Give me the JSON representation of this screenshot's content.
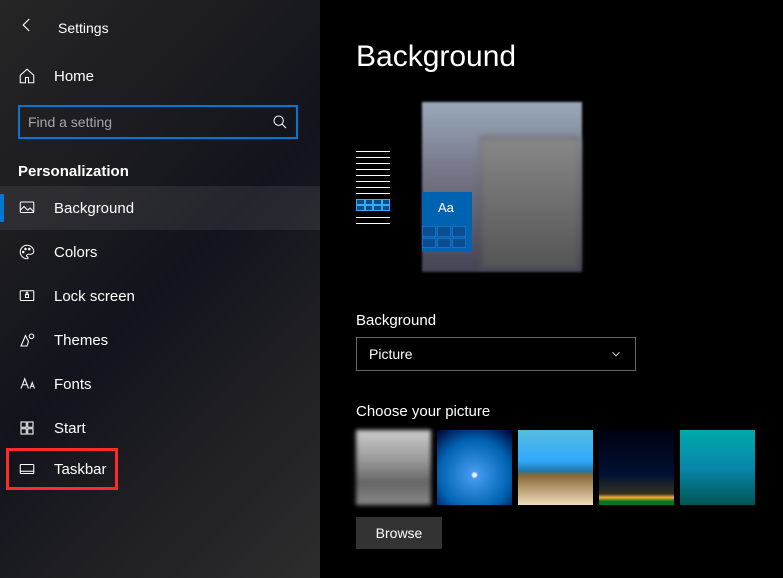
{
  "app": {
    "title": "Settings"
  },
  "sidebar": {
    "home": "Home",
    "search_placeholder": "Find a setting",
    "section": "Personalization",
    "items": [
      {
        "label": "Background",
        "active": true
      },
      {
        "label": "Colors"
      },
      {
        "label": "Lock screen"
      },
      {
        "label": "Themes"
      },
      {
        "label": "Fonts"
      },
      {
        "label": "Start"
      },
      {
        "label": "Taskbar",
        "highlighted": true
      }
    ]
  },
  "main": {
    "title": "Background",
    "preview_sample_text": "Aa",
    "bg_label": "Background",
    "bg_value": "Picture",
    "choose_label": "Choose your picture",
    "browse": "Browse"
  }
}
